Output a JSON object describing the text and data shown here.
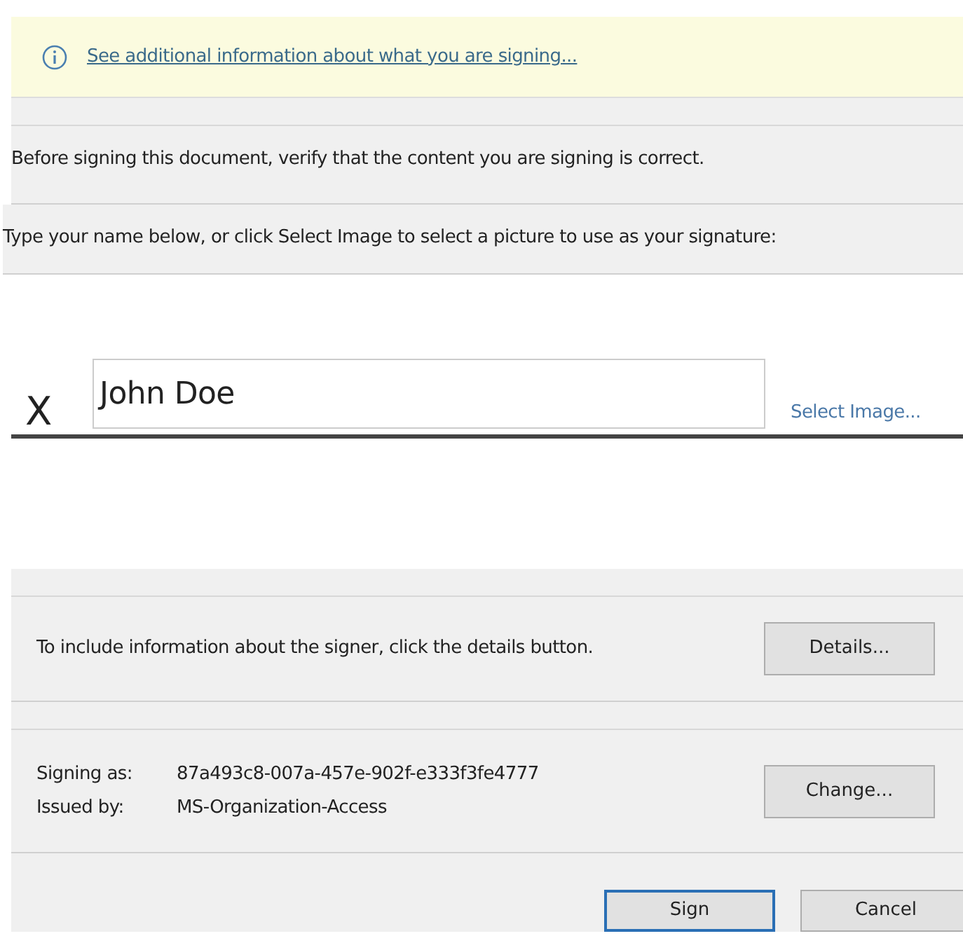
{
  "info_banner": {
    "link": "See additional information about what you are signing..."
  },
  "verify_message": "Before signing this document, verify that the content you are signing is correct.",
  "instructions": {
    "text": "Type your name below, or click Select Image to select a picture to use as your signature:"
  },
  "signature": {
    "mark": "X",
    "value": "John Doe",
    "select_image_link": "Select Image..."
  },
  "signer_info": {
    "text": "To include information about the signer, click the details button.",
    "button": {
      "label": "Details..."
    }
  },
  "certificate": {
    "fields": [
      {
        "label": "Signing as:",
        "value": "87a493c8-007a-457e-902f-e333f3fe4777"
      },
      {
        "label": "Issued by:",
        "value": "MS-Organization-Access"
      }
    ],
    "button": {
      "label": "Change..."
    }
  },
  "buttons": [
    {
      "label": "Sign",
      "default": true
    },
    {
      "label": "Cancel",
      "default": false
    }
  ]
}
